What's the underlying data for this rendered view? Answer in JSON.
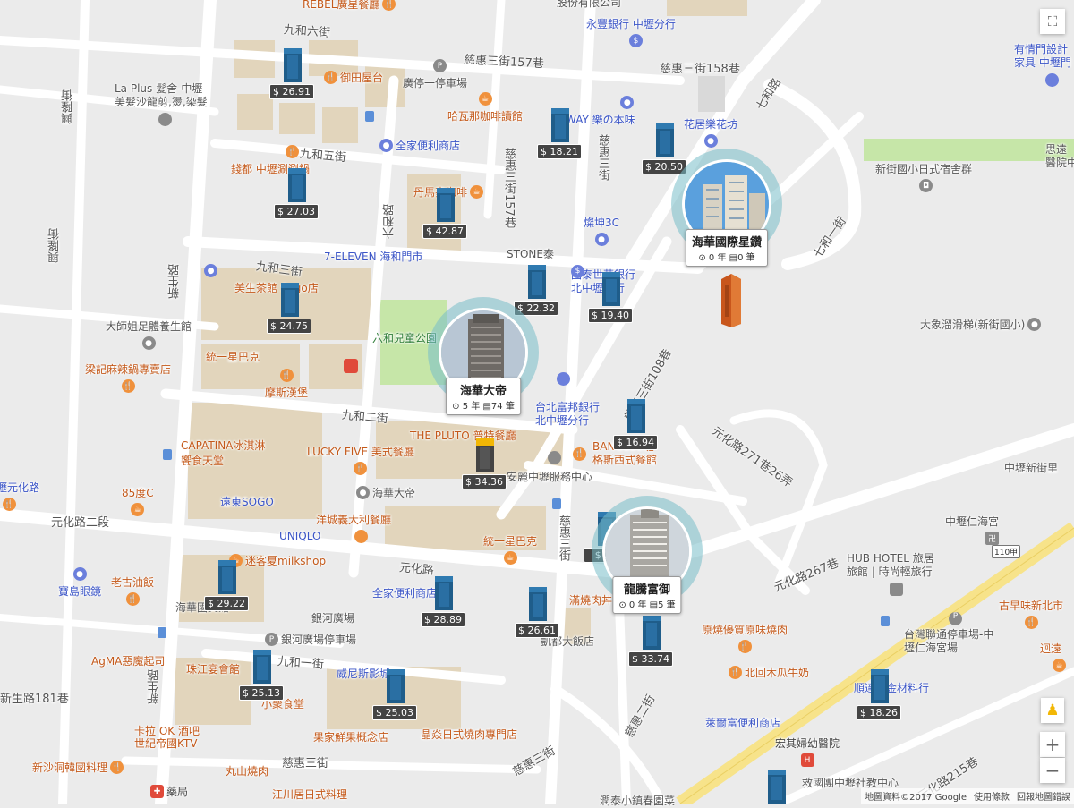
{
  "roads": [
    {
      "name": "九和六街"
    },
    {
      "name": "慈惠三街157巷"
    },
    {
      "name": "慈惠三街158巷"
    },
    {
      "name": "七和路"
    },
    {
      "name": "九和五街"
    },
    {
      "name": "慈惠三街157巷"
    },
    {
      "name": "慈惠三街"
    },
    {
      "name": "七和一街"
    },
    {
      "name": "六和路"
    },
    {
      "name": "九和三街"
    },
    {
      "name": "新生路"
    },
    {
      "name": "興隆街"
    },
    {
      "name": "興隆街"
    },
    {
      "name": "慈惠三街108巷"
    },
    {
      "name": "九和二街"
    },
    {
      "name": "元化路271巷26弄"
    },
    {
      "name": "元化路二段"
    },
    {
      "name": "元化路"
    },
    {
      "name": "元化路267巷"
    },
    {
      "name": "慈惠三街"
    },
    {
      "name": "九和一街"
    },
    {
      "name": "新生路181巷"
    },
    {
      "name": "新生路"
    },
    {
      "name": "慈惠三街"
    },
    {
      "name": "慈惠二街"
    },
    {
      "name": "慈惠三街"
    },
    {
      "name": "元化路215巷"
    }
  ],
  "pois": [
    {
      "name": "REBEL廣星餐廳",
      "kind": "food"
    },
    {
      "name": "股份有限公司",
      "kind": "gen"
    },
    {
      "name": "永豐銀行 中壢分行",
      "kind": "shop"
    },
    {
      "name": "有情門設計\n家具 中壢門",
      "kind": "shop"
    },
    {
      "name": "御田屋台",
      "kind": "food"
    },
    {
      "name": "廣停一停車場",
      "kind": "gen"
    },
    {
      "name": "La Plus 髮舍-中壢\n美髮沙龍剪,燙,染髮",
      "kind": "gen"
    },
    {
      "name": "哈瓦那咖啡讀館",
      "kind": "food"
    },
    {
      "name": "WAY 樂の本味",
      "kind": "shop"
    },
    {
      "name": "花居樂花坊",
      "kind": "shop"
    },
    {
      "name": "全家便利商店",
      "kind": "shop"
    },
    {
      "name": "錢都 中壢涮涮鍋",
      "kind": "food"
    },
    {
      "name": "丹馬麥咖啡",
      "kind": "food"
    },
    {
      "name": "新街國小日式宿舍群",
      "kind": "gen"
    },
    {
      "name": "思遠\n醫院中",
      "kind": "gen"
    },
    {
      "name": "燦坤3C",
      "kind": "shop"
    },
    {
      "name": "7-ELEVEN 海和門市",
      "kind": "shop"
    },
    {
      "name": "STONE泰",
      "kind": "gen"
    },
    {
      "name": "國泰世華銀行\n北中壢分行",
      "kind": "shop"
    },
    {
      "name": "美生茶館 Sogo店",
      "kind": "food"
    },
    {
      "name": "大師姐足體養生館",
      "kind": "gen"
    },
    {
      "name": "六和兒童公園",
      "kind": "rec"
    },
    {
      "name": "大象溜滑梯(新街國小)",
      "kind": "gen"
    },
    {
      "name": "統一星巴克",
      "kind": "food"
    },
    {
      "name": "梁記麻辣鍋專賣店",
      "kind": "food"
    },
    {
      "name": "摩斯漢堡",
      "kind": "food"
    },
    {
      "name": "台北富邦銀行\n北中壢分行",
      "kind": "shop"
    },
    {
      "name": "CAPATINA冰淇淋\n饗食天堂",
      "kind": "food"
    },
    {
      "name": "LUCKY FIVE 美式餐廳",
      "kind": "food"
    },
    {
      "name": "THE PLUTO 普特餐廳",
      "kind": "food"
    },
    {
      "name": "BANGLES班\n格斯西式餐館",
      "kind": "food"
    },
    {
      "name": "安麗中壢服務中心",
      "kind": "gen"
    },
    {
      "name": "中壢新街里",
      "kind": "gen"
    },
    {
      "name": "壢元化路",
      "kind": "shop"
    },
    {
      "name": "85度C",
      "kind": "food"
    },
    {
      "name": "遠東SOGO",
      "kind": "shop"
    },
    {
      "name": "海華大帝",
      "kind": "gen"
    },
    {
      "name": "洋城義大利餐廳",
      "kind": "food"
    },
    {
      "name": "UNIQLO",
      "kind": "shop"
    },
    {
      "name": "統一星巴克",
      "kind": "food"
    },
    {
      "name": "中壢仁海宮",
      "kind": "gen"
    },
    {
      "name": "HUB HOTEL 旅居\n旅館 | 時尚輕旅行",
      "kind": "gen"
    },
    {
      "name": "迷客夏milkshop",
      "kind": "food"
    },
    {
      "name": "寶島眼鏡",
      "kind": "shop"
    },
    {
      "name": "老古油飯",
      "kind": "food"
    },
    {
      "name": "全家便利商店",
      "kind": "shop"
    },
    {
      "name": "滿燒肉丼",
      "kind": "food"
    },
    {
      "name": "海華國美館",
      "kind": "gen"
    },
    {
      "name": "銀河廣場",
      "kind": "gen"
    },
    {
      "name": "原燒優質原味燒肉",
      "kind": "food"
    },
    {
      "name": "古早味新北市",
      "kind": "food"
    },
    {
      "name": "凱都大飯店",
      "kind": "gen"
    },
    {
      "name": "銀河廣場停車場",
      "kind": "gen"
    },
    {
      "name": "台灣聯通停車場-中\n壢仁海宮場",
      "kind": "gen"
    },
    {
      "name": "迴遠",
      "kind": "food"
    },
    {
      "name": "AgMA惡魔起司",
      "kind": "food"
    },
    {
      "name": "珠江宴會館",
      "kind": "food"
    },
    {
      "name": "威尼斯影城",
      "kind": "shop"
    },
    {
      "name": "北回木瓜牛奶",
      "kind": "food"
    },
    {
      "name": "順達五金材料行",
      "kind": "shop"
    },
    {
      "name": "小聚食堂",
      "kind": "food"
    },
    {
      "name": "卡拉 OK 酒吧\n世紀帝國KTV",
      "kind": "food"
    },
    {
      "name": "果家鮮果概念店",
      "kind": "food"
    },
    {
      "name": "晶焱日式燒肉專門店",
      "kind": "food"
    },
    {
      "name": "萊爾富便利商店",
      "kind": "shop"
    },
    {
      "name": "宏其婦幼醫院",
      "kind": "med"
    },
    {
      "name": "新沙洞韓國料理",
      "kind": "food"
    },
    {
      "name": "救國團中壢社教中心",
      "kind": "gen"
    },
    {
      "name": "丸山燒肉",
      "kind": "food"
    },
    {
      "name": "藥局",
      "kind": "med"
    },
    {
      "name": "江川居日式料理",
      "kind": "food"
    },
    {
      "name": "潤泰小鎮春園菜",
      "kind": "gen"
    }
  ],
  "markers": [
    {
      "price": "$ 26.91"
    },
    {
      "price": "$ 18.21"
    },
    {
      "price": "$ 20.50"
    },
    {
      "price": "$ 27.03"
    },
    {
      "price": "$ 42.87"
    },
    {
      "price": "$ 22.32"
    },
    {
      "price": "$ 19.40"
    },
    {
      "price": "$ 24.75"
    },
    {
      "price": "$ 16.94"
    },
    {
      "price": "$ 34.36"
    },
    {
      "price": "$ 29.22"
    },
    {
      "price": "$ 28.89"
    },
    {
      "price": "$ 26.61"
    },
    {
      "price": "$ 33.74"
    },
    {
      "price": "$ 25.13"
    },
    {
      "price": "$ 25.03"
    },
    {
      "price": "$ 18.26"
    },
    {
      "price": "$ 25"
    }
  ],
  "featured": [
    {
      "name": "海華國際星鑽",
      "age": "0 年",
      "count": "0 筆"
    },
    {
      "name": "海華大帝",
      "age": "5 年",
      "count": "74 筆"
    },
    {
      "name": "龍騰富御",
      "age": "0 年",
      "count": "5 筆"
    }
  ],
  "controls": {
    "zoom_in": "+",
    "zoom_out": "−",
    "fullscreen": "⛶",
    "pegman": "♟"
  },
  "attribution": {
    "data": "地圖資料©2017 Google",
    "terms": "使用條款",
    "report": "回報地圖錯誤"
  },
  "colors": {
    "road": "#ffffff",
    "block": "#e2d5bc",
    "park": "#c6e6a8",
    "highway": "#f7e38a",
    "price_bg": "#444444",
    "building": "#1f5d8a",
    "bubble_ring": "#78bec8"
  }
}
